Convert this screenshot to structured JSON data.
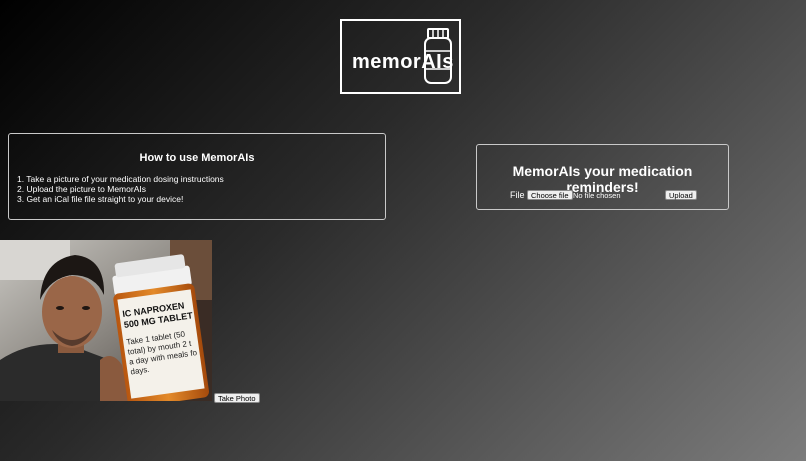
{
  "logo": {
    "text": "memorAIs"
  },
  "howto": {
    "title": "How to use MemorAIs",
    "steps": [
      "1. Take a picture of your medication dosing instructions",
      "2. Upload the picture to MemorAIs",
      "3. Get an iCal file file straight to your device!"
    ]
  },
  "upload": {
    "title": "MemorAIs your medication reminders!",
    "file_label": "File",
    "choose_file_label": "Choose file",
    "no_file_text": "No file chosen",
    "upload_label": "Upload"
  },
  "camera": {
    "bottle_label_lines": [
      "IC NAPROXEN",
      "500 MG TABLET",
      "Take 1 tablet (50",
      "total) by mouth 2 t",
      "a day with meals fo",
      "days."
    ],
    "take_photo_label": "Take Photo"
  },
  "colors": {
    "text": "#ffffff",
    "border": "#c9c9c9",
    "button_bg": "#efefef"
  }
}
